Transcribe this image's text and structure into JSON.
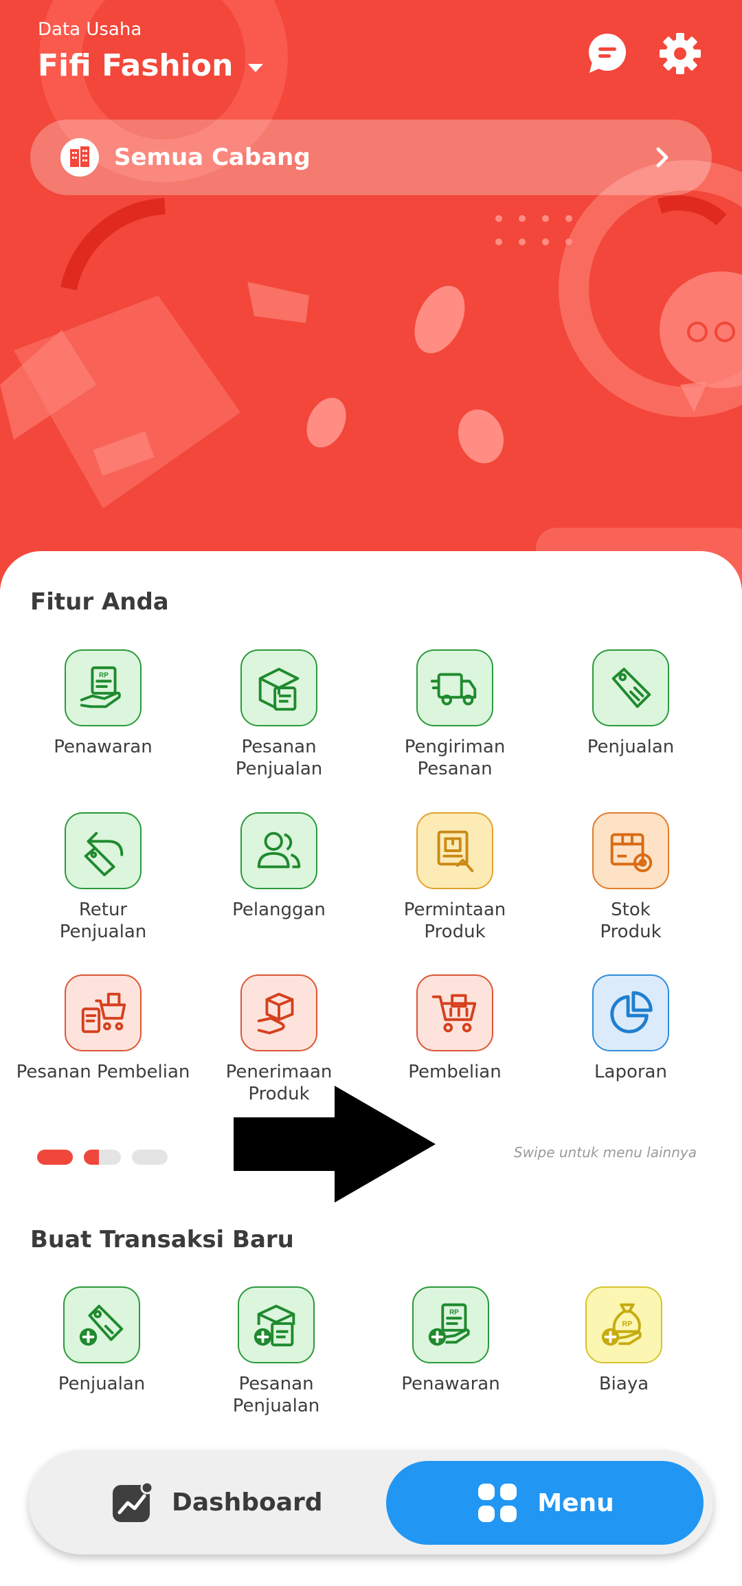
{
  "header": {
    "caption": "Data Usaha",
    "business_name": "Fifi Fashion",
    "branch_label": "Semua Cabang"
  },
  "icons": {
    "chat": "chat-bubble-icon",
    "settings": "gear-icon",
    "branch": "building-icon",
    "branch_chevron": "chevron-right-icon"
  },
  "features": {
    "title": "Fitur Anda",
    "items": [
      {
        "label": "Penawaran",
        "icon": "quotation-hand-icon",
        "color": "green"
      },
      {
        "label": "Pesanan\nPenjualan",
        "icon": "sales-order-box-icon",
        "color": "green"
      },
      {
        "label": "Pengiriman\nPesanan",
        "icon": "delivery-truck-icon",
        "color": "green"
      },
      {
        "label": "Penjualan",
        "icon": "price-tag-icon",
        "color": "green"
      },
      {
        "label": "Retur\nPenjualan",
        "icon": "return-tag-icon",
        "color": "green"
      },
      {
        "label": "Pelanggan",
        "icon": "customers-icon",
        "color": "green"
      },
      {
        "label": "Permintaan\nProduk",
        "icon": "product-request-icon",
        "color": "yellow"
      },
      {
        "label": "Stok\nProduk",
        "icon": "stock-box-gear-icon",
        "color": "orange"
      },
      {
        "label": "Pesanan Pembelian",
        "icon": "purchase-order-cart-icon",
        "color": "red"
      },
      {
        "label": "Penerimaan\nProduk",
        "icon": "receive-box-icon",
        "color": "red"
      },
      {
        "label": "Pembelian",
        "icon": "shopping-cart-icon",
        "color": "red"
      },
      {
        "label": "Laporan",
        "icon": "pie-chart-icon",
        "color": "blue"
      }
    ],
    "pager": {
      "pages": 3,
      "current": 1
    },
    "swipe_hint": "Swipe untuk menu lainnya"
  },
  "new_transaction": {
    "title": "Buat Transaksi Baru",
    "items": [
      {
        "label": "Penjualan",
        "icon": "add-sale-tag-icon",
        "color": "green"
      },
      {
        "label": "Pesanan\nPenjualan",
        "icon": "add-sales-order-icon",
        "color": "green"
      },
      {
        "label": "Penawaran",
        "icon": "add-quotation-icon",
        "color": "green"
      },
      {
        "label": "Biaya",
        "icon": "add-expense-bag-icon",
        "color": "lime"
      }
    ]
  },
  "bottom_nav": {
    "dashboard_label": "Dashboard",
    "menu_label": "Menu",
    "active": "Menu"
  },
  "colors": {
    "hero": "#f2473a",
    "primary_blue": "#2196f3",
    "pager_active": "#f0473c"
  }
}
